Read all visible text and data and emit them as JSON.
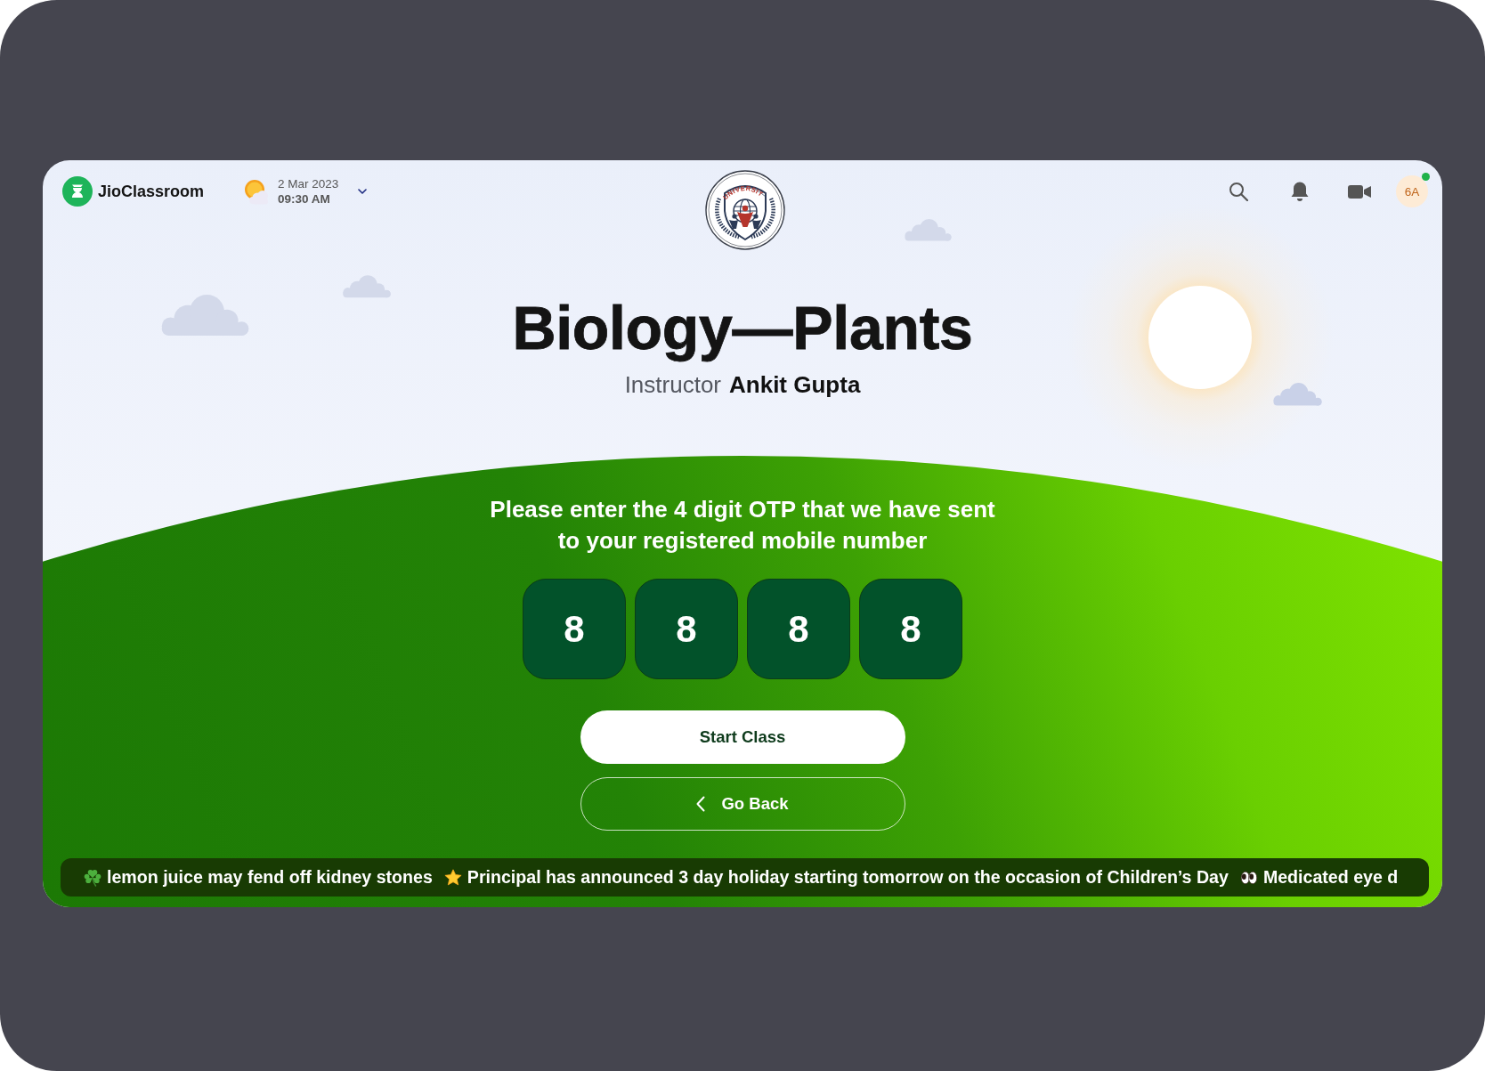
{
  "top_bar": {
    "app_name": "JioClassroom",
    "date": "2 Mar 2023",
    "time": "09:30 AM",
    "emblem_text": "UNIVERSITY",
    "avatar": {
      "initials": "6A",
      "online": true
    }
  },
  "class": {
    "title": "Biology—Plants",
    "instructor_label": "Instructor",
    "instructor_name": "Ankit Gupta"
  },
  "otp": {
    "prompt_lines": [
      "Please enter the 4 digit OTP that we have sent",
      "to your registered mobile number"
    ],
    "digits": [
      "8",
      "8",
      "8",
      "8"
    ]
  },
  "buttons": [
    {
      "kind": "primary",
      "label": "Start Class"
    },
    {
      "kind": "back",
      "label": "Go Back"
    }
  ],
  "ticker": {
    "items": [
      {
        "kind": "shamrock",
        "text": "lemon juice may fend off kidney stones"
      },
      {
        "kind": "star",
        "text": "Principal has announced 3 day holiday starting tomorrow on the occasion of Children’s Day"
      },
      {
        "kind": "eyes",
        "text": "Medicated eye d"
      }
    ]
  }
}
